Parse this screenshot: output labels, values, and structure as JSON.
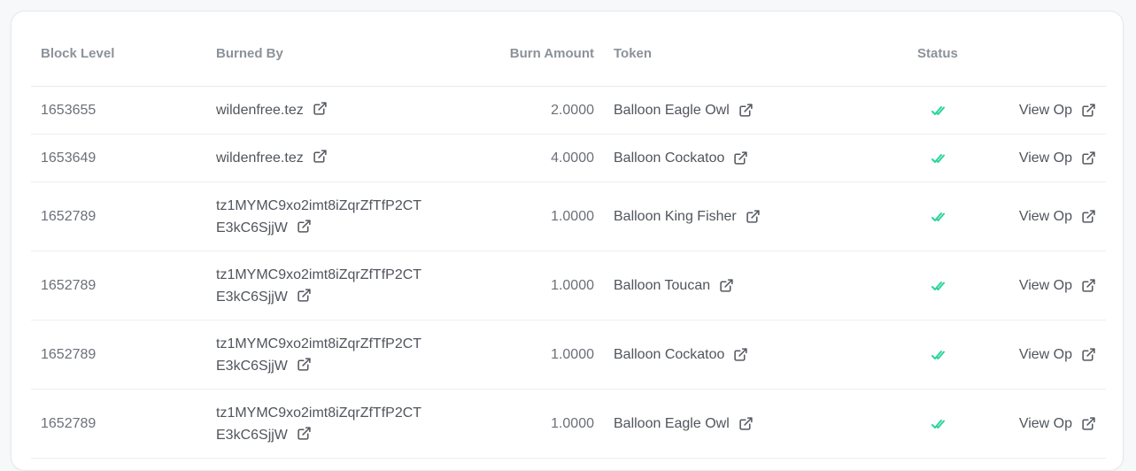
{
  "columns": {
    "block_level": "Block Level",
    "burned_by": "Burned By",
    "burn_amount": "Burn Amount",
    "token": "Token",
    "status": "Status"
  },
  "rows": [
    {
      "block": "1653655",
      "burned_by": [
        "wildenfree.tez"
      ],
      "amount": "2.0000",
      "token": "Balloon Eagle Owl",
      "status": "confirmed",
      "view": "View Op"
    },
    {
      "block": "1653649",
      "burned_by": [
        "wildenfree.tez"
      ],
      "amount": "4.0000",
      "token": "Balloon Cockatoo",
      "status": "confirmed",
      "view": "View Op"
    },
    {
      "block": "1652789",
      "burned_by": [
        "tz1MYMC9xo2imt8iZqrZfTfP2CT",
        "E3kC6SjjW"
      ],
      "amount": "1.0000",
      "token": "Balloon King Fisher",
      "status": "confirmed",
      "view": "View Op"
    },
    {
      "block": "1652789",
      "burned_by": [
        "tz1MYMC9xo2imt8iZqrZfTfP2CT",
        "E3kC6SjjW"
      ],
      "amount": "1.0000",
      "token": "Balloon Toucan",
      "status": "confirmed",
      "view": "View Op"
    },
    {
      "block": "1652789",
      "burned_by": [
        "tz1MYMC9xo2imt8iZqrZfTfP2CT",
        "E3kC6SjjW"
      ],
      "amount": "1.0000",
      "token": "Balloon Cockatoo",
      "status": "confirmed",
      "view": "View Op"
    },
    {
      "block": "1652789",
      "burned_by": [
        "tz1MYMC9xo2imt8iZqrZfTfP2CT",
        "E3kC6SjjW"
      ],
      "amount": "1.0000",
      "token": "Balloon Eagle Owl",
      "status": "confirmed",
      "view": "View Op"
    }
  ],
  "icons": {
    "link": "external-link-icon",
    "status": "double-check-icon"
  },
  "colors": {
    "status_check": "#2bd39a",
    "header_text": "#8c9299",
    "body_text": "#50555c"
  }
}
